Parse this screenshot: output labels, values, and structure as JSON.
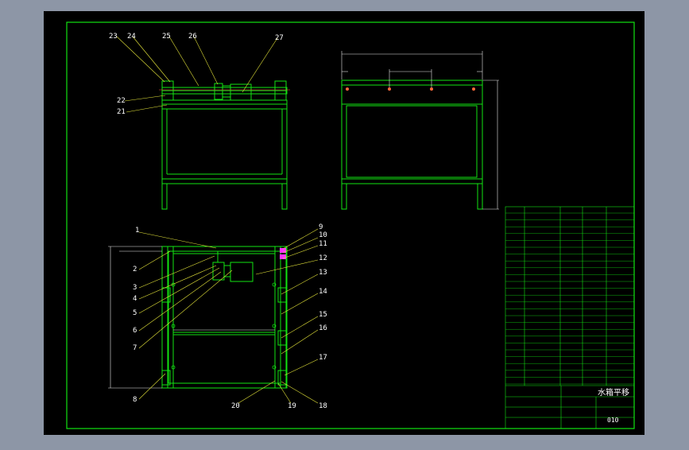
{
  "colors": {
    "background": "#8d96a6",
    "paper": "#000000",
    "frame": "#12e312",
    "leader": "#e6e63a",
    "dimension": "#e6e6e6",
    "accent": "#ff33ff",
    "text": "#ffffff"
  },
  "callouts": {
    "top_view": [
      "23",
      "24",
      "25",
      "26",
      "27",
      "22",
      "21"
    ],
    "left_col": [
      "1",
      "2",
      "3",
      "4",
      "5",
      "6",
      "7",
      "8"
    ],
    "right_col": [
      "9",
      "10",
      "11",
      "12",
      "13",
      "14",
      "15",
      "16",
      "17",
      "18",
      "19",
      "20"
    ]
  },
  "title_block": {
    "title": "水箱平移",
    "drawing_no": "010"
  }
}
